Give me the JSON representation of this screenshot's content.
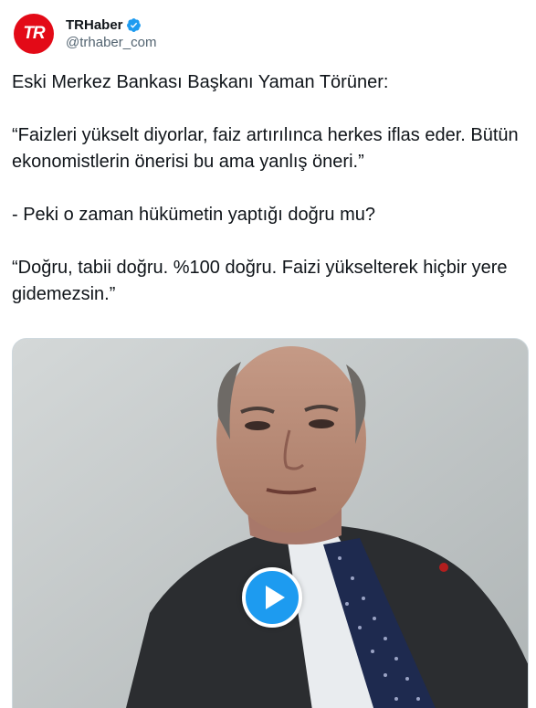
{
  "author": {
    "avatar_text": "TR",
    "display_name": "TRHaber",
    "handle": "@trhaber_com",
    "verified": true,
    "verified_icon": "verified-badge-icon"
  },
  "tweet": {
    "line1": "Eski Merkez Bankası Başkanı Yaman Törüner:",
    "line2": "“Faizleri yükselt diyorlar, faiz artırılınca herkes iflas eder. Bütün ekonomistlerin önerisi bu ama yanlış öneri.”",
    "line3": "- Peki o zaman hükümetin yaptığı doğru mu?",
    "line4": "“Doğru, tabii doğru. %100 doğru. Faizi yükselterek hiçbir yere gidemezsin.”"
  },
  "media": {
    "type": "video",
    "play_icon": "play-icon"
  },
  "colors": {
    "brand_red": "#e30a17",
    "accent_blue": "#1d9bf0",
    "text_primary": "#0f1419",
    "text_secondary": "#536471"
  }
}
